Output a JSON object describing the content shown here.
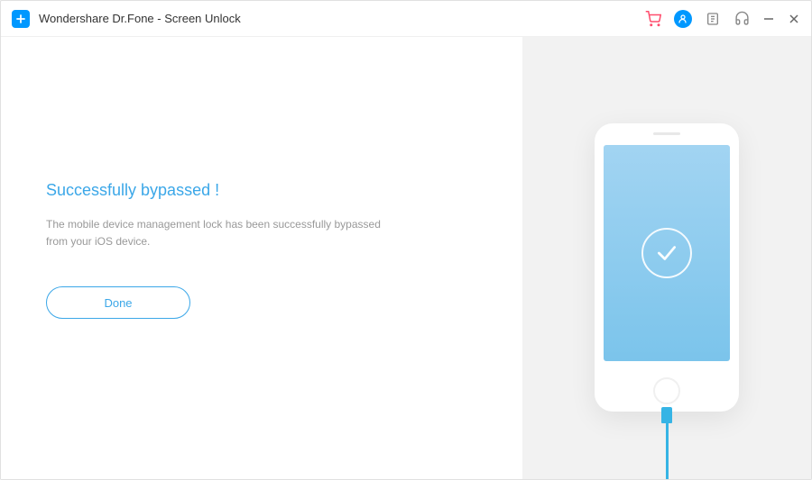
{
  "app": {
    "title": "Wondershare Dr.Fone - Screen Unlock"
  },
  "main": {
    "heading": "Successfully bypassed !",
    "description": "The mobile device management lock has been successfully bypassed from your iOS device.",
    "done_label": "Done"
  },
  "colors": {
    "accent": "#3BA7E8",
    "brand": "#0098FF",
    "cart": "#FF4D6D"
  }
}
